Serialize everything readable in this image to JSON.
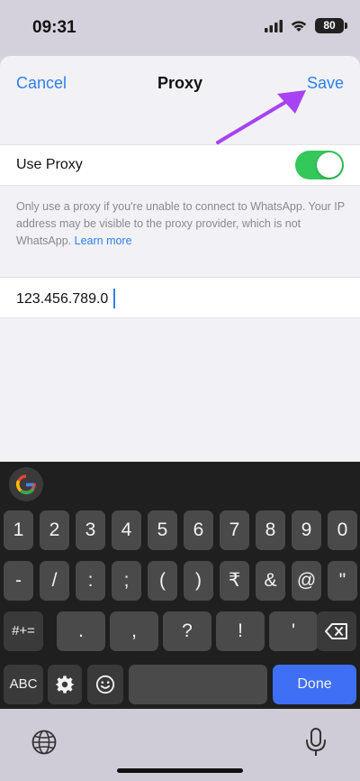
{
  "status_bar": {
    "time": "09:31",
    "battery": "80"
  },
  "nav": {
    "cancel_label": "Cancel",
    "title": "Proxy",
    "save_label": "Save"
  },
  "proxy_setting": {
    "label": "Use Proxy",
    "enabled": true
  },
  "footnote": {
    "text": "Only use a proxy if you're unable to connect to WhatsApp. Your IP address may be visible to the proxy provider, which is not WhatsApp.",
    "link": "Learn more"
  },
  "address": {
    "value": "123.456.789.0"
  },
  "keyboard": {
    "row1": [
      "1",
      "2",
      "3",
      "4",
      "5",
      "6",
      "7",
      "8",
      "9",
      "0"
    ],
    "row2": [
      "-",
      "/",
      ":",
      ";",
      "(",
      ")",
      "₹",
      "&",
      "@",
      "\""
    ],
    "row3_toggle": "#+=",
    "row3": [
      ".",
      ",",
      "?",
      "!",
      "'"
    ],
    "abc_label": "ABC",
    "done_label": "Done"
  },
  "colors": {
    "accent": "#2f80ed",
    "toggle_on": "#34c759",
    "annotation_arrow": "#a742f5",
    "done_key": "#3e6ff5"
  }
}
